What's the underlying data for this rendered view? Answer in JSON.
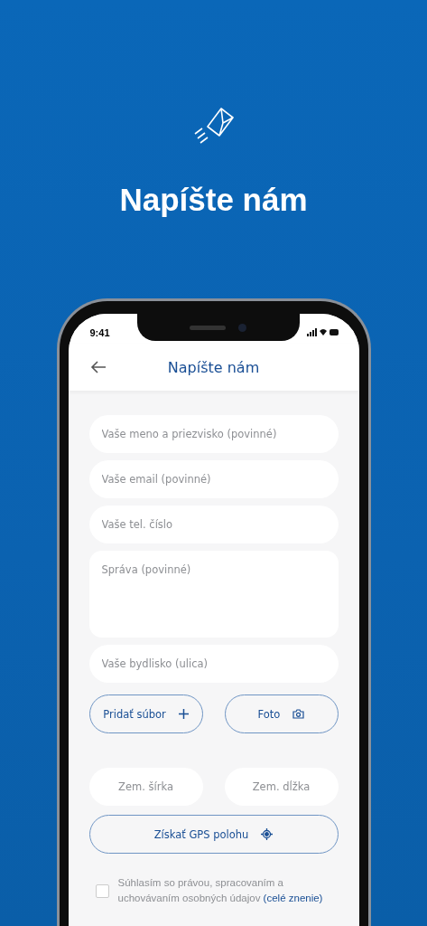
{
  "hero": {
    "title": "Napíšte nám"
  },
  "status_bar": {
    "time": "9:41"
  },
  "header": {
    "title": "Napíšte nám"
  },
  "fields": [
    {
      "kind": "input",
      "placeholder": "Vaše meno a priezvisko (povinné)"
    },
    {
      "kind": "input",
      "placeholder": "Vaše email (povinné)"
    },
    {
      "kind": "input",
      "placeholder": "Vaše tel. číslo"
    },
    {
      "kind": "textarea",
      "placeholder": "Správa (povinné)"
    },
    {
      "kind": "input",
      "placeholder": "Vaše bydlisko (ulica)"
    }
  ],
  "attach_buttons": [
    {
      "label": "Pridať súbor",
      "kind": "plus"
    },
    {
      "label": "Foto",
      "kind": "camera"
    }
  ],
  "coordinates": [
    {
      "placeholder": "Zem. šírka"
    },
    {
      "placeholder": "Zem. dĺžka"
    }
  ],
  "gps_button": {
    "label": "Získať GPS polohu"
  },
  "consent": {
    "checked": false,
    "text": "Súhlasím so právou, spracovaním a uchovávaním osobných údajov",
    "link": "(celé znenie)"
  }
}
